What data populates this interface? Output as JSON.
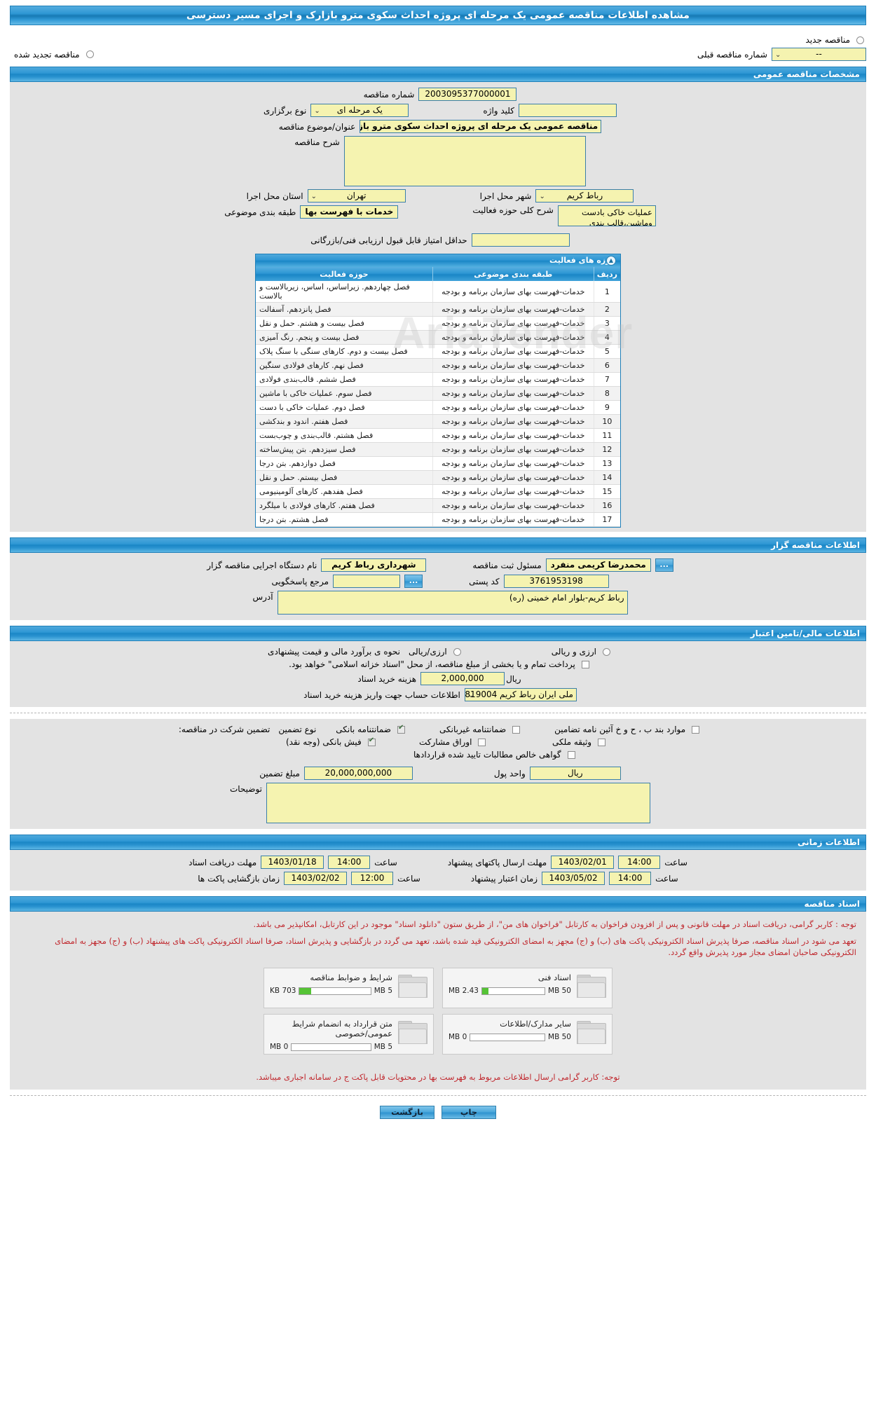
{
  "header": {
    "title": "مشاهده اطلاعات مناقصه عمومی یک مرحله ای پروژه احداث سکوی مترو بازارک و اجرای مسیر دسترسی"
  },
  "top_options": {
    "new_tender": "مناقصه جدید",
    "renewed_tender": "مناقصه تجدید شده",
    "prev_number_label": "شماره مناقصه قبلی",
    "prev_number_value": "--"
  },
  "general": {
    "section_title": "مشخصات مناقصه عمومی",
    "tender_no_label": "شماره مناقصه",
    "tender_no_value": "2003095377000001",
    "hold_type_label": "نوع برگزاری",
    "hold_type_value": "یک مرحله ای",
    "keyword_label": "کلید واژه",
    "keyword_value": "",
    "subject_label": "عنوان/موضوع مناقصه",
    "subject_value": "مناقصه عمومی یک مرحله ای پروژه احداث سکوی مترو بازارک و اجرای مسیر دسترسی",
    "desc_label": "شرح مناقصه",
    "desc_value": "",
    "province_label": "استان محل اجرا",
    "province_value": "تهران",
    "city_label": "شهر محل اجرا",
    "city_value": "رباط کریم",
    "classification_label": "طبقه بندی موضوعی",
    "classification_value": "خدمات با فهرست بها",
    "scope_label": "شرح کلی حوزه فعالیت",
    "scope_value": "عملیات خاکی بادست وماشین،قالب بندی",
    "min_score_label": "حداقل امتیاز قابل قبول ارزیابی فنی/بازرگانی",
    "min_score_value": ""
  },
  "activity_table": {
    "title": "حوزه های فعالیت",
    "columns": [
      "ردیف",
      "طبقه بندی موضوعی",
      "حوزه فعالیت"
    ],
    "rows": [
      {
        "no": "1",
        "class": "خدمات-فهرست بهای سازمان برنامه و بودجه",
        "area": "فصل چهاردهم. زیراساس، اساس، زیربالاست  و بالاست"
      },
      {
        "no": "2",
        "class": "خدمات-فهرست بهای سازمان برنامه و بودجه",
        "area": "فصل پانزدهم. آسفالت"
      },
      {
        "no": "3",
        "class": "خدمات-فهرست بهای سازمان برنامه و بودجه",
        "area": "فصل بیست و هشتم. حمل و نقل"
      },
      {
        "no": "4",
        "class": "خدمات-فهرست بهای سازمان برنامه و بودجه",
        "area": "فصل بیست و پنجم. رنگ آمیزی"
      },
      {
        "no": "5",
        "class": "خدمات-فهرست بهای سازمان برنامه و بودجه",
        "area": "فصل بیست و دوم. کارهای سنگی با سنگ پلاک"
      },
      {
        "no": "6",
        "class": "خدمات-فهرست بهای سازمان برنامه و بودجه",
        "area": "فصل نهم. کارهای فولادی سنگین"
      },
      {
        "no": "7",
        "class": "خدمات-فهرست بهای سازمان برنامه و بودجه",
        "area": "فصل ششم. قالب‌بندی فولادی"
      },
      {
        "no": "8",
        "class": "خدمات-فهرست بهای سازمان برنامه و بودجه",
        "area": "فصل سوم. عملیات خاکی با ماشین"
      },
      {
        "no": "9",
        "class": "خدمات-فهرست بهای سازمان برنامه و بودجه",
        "area": "فصل دوم. عملیات خاکی با دست"
      },
      {
        "no": "10",
        "class": "خدمات-فهرست بهای سازمان برنامه و بودجه",
        "area": "فصل هفتم. اندود و بندکشی"
      },
      {
        "no": "11",
        "class": "خدمات-فهرست بهای سازمان برنامه و بودجه",
        "area": "فصل هشتم. قالب‌بندی و چوب‌بست"
      },
      {
        "no": "12",
        "class": "خدمات-فهرست بهای سازمان برنامه و بودجه",
        "area": "فصل سیزدهم. بتن پیش‌ساخته"
      },
      {
        "no": "13",
        "class": "خدمات-فهرست بهای سازمان برنامه و بودجه",
        "area": "فصل دوازدهم. بتن درجا"
      },
      {
        "no": "14",
        "class": "خدمات-فهرست بهای سازمان برنامه و بودجه",
        "area": "فصل بیستم. حمل و نقل"
      },
      {
        "no": "15",
        "class": "خدمات-فهرست بهای سازمان برنامه و بودجه",
        "area": "فصل هفدهم. کارهای آلومینیومی"
      },
      {
        "no": "16",
        "class": "خدمات-فهرست بهای سازمان برنامه و بودجه",
        "area": "فصل هفتم. کارهای فولادی با میلگرد"
      },
      {
        "no": "17",
        "class": "خدمات-فهرست بهای سازمان برنامه و بودجه",
        "area": "فصل هشتم. بتن درجا"
      }
    ]
  },
  "organizer": {
    "section_title": "اطلاعات مناقصه گزار",
    "org_name_label": "نام دستگاه اجرایی مناقصه گزار",
    "org_name_value": "شهرداری رباط کریم",
    "registrar_label": "مسئول ثبت مناقصه",
    "registrar_value": "محمدرضا کریمی منفرد",
    "dots_button": "...",
    "contact_label": "مرجع پاسخگویی",
    "contact_value": "",
    "postal_label": "کد پستی",
    "postal_value": "3761953198",
    "address_label": "آدرس",
    "address_value": "رباط کریم-بلوار امام خمینی (ره)"
  },
  "financial": {
    "section_title": "اطلاعات مالی/تامین اعتبار",
    "estimate_label": "نحوه ی برآورد مالی و قیمت پیشنهادی",
    "option_rial": "ارزی/ریالی",
    "option_both": "ارزی و ریالی",
    "treasury_note": "پرداخت تمام و یا بخشی از مبلغ مناقصه، از محل \"اسناد خزانه اسلامی\" خواهد بود.",
    "doc_cost_label": "هزینه خرید اسناد",
    "doc_cost_value": "2,000,000",
    "doc_cost_unit": "ریال",
    "bank_label": "اطلاعات حساب جهت واریز هزینه خرید اسناد",
    "bank_value": "ملی ایران رباط کریم 819004"
  },
  "guarantee": {
    "type_label": "نوع تضمین",
    "participation_label": "تضمین شرکت در مناقصه:",
    "options": [
      {
        "label": "ضمانتنامه بانکی",
        "checked": true
      },
      {
        "label": "ضمانتنامه غیربانکی",
        "checked": false
      },
      {
        "label": "موارد بند ب ، ح و خ آئین نامه تضامین",
        "checked": false
      },
      {
        "label": "فیش بانکی (وجه نقد)",
        "checked": true
      },
      {
        "label": "اوراق مشارکت",
        "checked": false
      },
      {
        "label": "وثیقه ملکی",
        "checked": false
      },
      {
        "label": "گواهی خالص مطالبات تایید شده قراردادها",
        "checked": false
      }
    ],
    "amount_label": "مبلغ تضمین",
    "amount_value": "20,000,000,000",
    "currency_label": "واحد پول",
    "currency_value": "ریال",
    "notes_label": "توضیحات",
    "notes_value": ""
  },
  "timing": {
    "section_title": "اطلاعات زمانی",
    "receive_docs_label": "مهلت دریافت اسناد",
    "receive_docs_date": "1403/01/18",
    "receive_docs_time_label": "ساعت",
    "receive_docs_time": "14:00",
    "submit_label": "مهلت ارسال پاکتهای پیشنهاد",
    "submit_date": "1403/02/01",
    "submit_time_label": "ساعت",
    "submit_time": "14:00",
    "open_label": "زمان بازگشایی پاکت ها",
    "open_date": "1403/02/02",
    "open_time_label": "ساعت",
    "open_time": "12:00",
    "validity_label": "زمان اعتبار پیشنهاد",
    "validity_date": "1403/05/02",
    "validity_time_label": "ساعت",
    "validity_time": "14:00"
  },
  "documents": {
    "section_title": "اسناد مناقصه",
    "notice_1": "توجه : کاربر گرامی، دریافت اسناد در مهلت قانونی و پس از افزودن فراخوان به کارتابل \"فراخوان های من\"، از طریق ستون \"دانلود اسناد\" موجود در این کارتابل، امکانپذیر می باشد.",
    "notice_2": "تعهد می شود در اسناد مناقصه، صرفا پذیرش اسناد الکترونیکی پاکت های (ب) و (ج) مجهز به امضای الکترونیکی قید شده باشد، تعهد می گردد در بازگشایی و پذیرش اسناد، صرفا اسناد الکترونیکی پاکت های پیشنهاد (ب) و (ج) مجهز به امضای الکترونیکی صاحبان امضای مجاز مورد پذیرش واقع گردد.",
    "cards": [
      {
        "title": "شرایط و ضوابط مناقصه",
        "size": "703 KB",
        "max": "5 MB",
        "fill": 16
      },
      {
        "title": "اسناد فنی",
        "size": "2.43 MB",
        "max": "50 MB",
        "fill": 10
      },
      {
        "title": "متن قرارداد به انضمام شرایط عمومی/خصوصی",
        "size": "0 MB",
        "max": "5 MB",
        "fill": 0
      },
      {
        "title": "سایر مدارک/اطلاعات",
        "size": "0 MB",
        "max": "50 MB",
        "fill": 0
      }
    ],
    "notice_3": "توجه: کاربر گرامی ارسال اطلاعات مربوط به فهرست بها در محتویات قابل پاکت ج در سامانه اجباری میباشد."
  },
  "footer": {
    "back_button": "بازگشت",
    "print_button": "چاپ"
  },
  "watermark": "AriaTender"
}
